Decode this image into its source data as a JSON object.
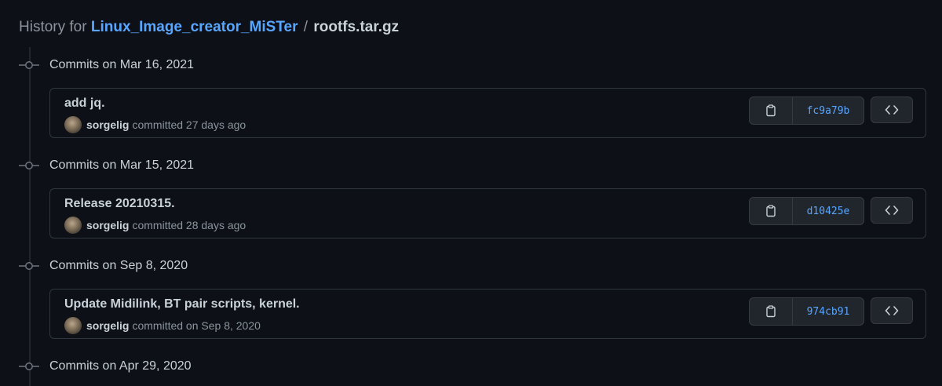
{
  "header": {
    "prefix": "History for",
    "repo": "Linux_Image_creator_MiSTer",
    "separator": "/",
    "file": "rootfs.tar.gz"
  },
  "groups": [
    {
      "title": "Commits on Mar 16, 2021",
      "commit": {
        "message": "add jq.",
        "author": "sorgelig",
        "meta": "committed 27 days ago",
        "sha": "fc9a79b"
      }
    },
    {
      "title": "Commits on Mar 15, 2021",
      "commit": {
        "message": "Release 20210315.",
        "author": "sorgelig",
        "meta": "committed 28 days ago",
        "sha": "d10425e"
      }
    },
    {
      "title": "Commits on Sep 8, 2020",
      "commit": {
        "message": "Update Midilink, BT pair scripts, kernel.",
        "author": "sorgelig",
        "meta": "committed on Sep 8, 2020",
        "sha": "974cb91"
      }
    },
    {
      "title": "Commits on Apr 29, 2020"
    }
  ],
  "icons": {
    "timeline_dot": "git-commit-icon",
    "copy": "clipboard-icon",
    "browse": "code-icon"
  },
  "colors": {
    "background": "#0d1117",
    "link": "#58a6ff",
    "border": "#30363d",
    "muted": "#8b949e",
    "text": "#c9d1d9"
  }
}
